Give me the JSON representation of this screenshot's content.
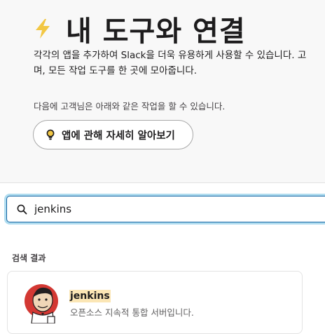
{
  "header": {
    "icon": "lightning-bolt-icon",
    "title": "내 도구와 연결",
    "description_line1": "각각의 앱을 추가하여 Slack을 더욱 유용하게 사용할 수 있습니다. 고",
    "description_line2": "며, 모든 작업 도구를 한 곳에 모아줍니다.",
    "subdescription": "다음에 고객님은 아래와 같은 작업을 할 수 있습니다.",
    "learn_button_label": "앱에 관해 자세히 알아보기",
    "learn_button_icon": "lightbulb-icon"
  },
  "search": {
    "icon": "search-icon",
    "value": "jenkins"
  },
  "results": {
    "label": "검색 결과",
    "items": [
      {
        "name": "jenkins",
        "description": "오픈소스 지속적 통합 서버입니다.",
        "icon": "jenkins-butler-logo"
      }
    ]
  },
  "colors": {
    "hero_background": "#f8f8f8",
    "focus_ring": "#1264a3",
    "highlight": "#fbe6b5",
    "bolt": "#f2c744"
  }
}
